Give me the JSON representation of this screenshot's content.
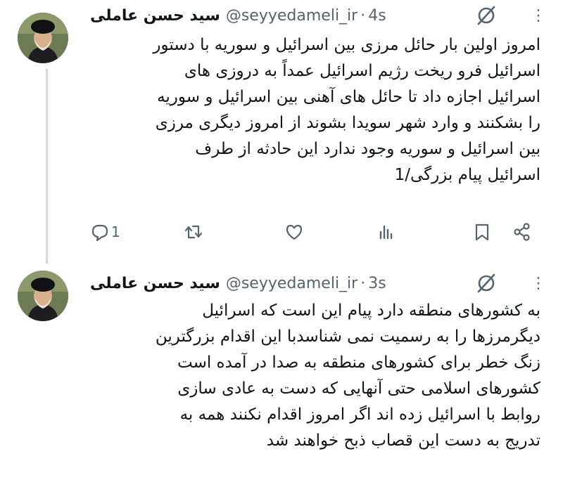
{
  "tweets": [
    {
      "author_name": "سید حسن عاملی",
      "handle": "@seyyedameli_ir",
      "separator": "·",
      "time": "4s",
      "lines": [
        "امروز اولین بار حائل مرزی بین اسرائیل و سوریه با دستور",
        "اسرائیل فرو ریخت رژیم اسرائیل عمداً به دروزی های",
        "اسرائیل اجازه داد تا حائل های آهنی بین اسرائیل و سوریه",
        "را بشکنند و وارد شهر سویدا بشوند از امروز دیگری مرزی",
        "بین اسرائیل و سوریه وجود ندارد این حادثه از طرف",
        "اسرائیل پیام بزرگی/1"
      ],
      "reply_count": "1"
    },
    {
      "author_name": "سید حسن عاملی",
      "handle": "@seyyedameli_ir",
      "separator": "·",
      "time": "3s",
      "lines": [
        "به کشورهای منطقه دارد پیام این است که اسرائیل",
        "دیگرمرزها را به رسمیت نمی شناسدبا این اقدام بزرگترین",
        "زنگ خطر برای کشورهای منطقه به صدا در آمده است",
        "کشورهای اسلامی حتی آنهایی که دست به عادی سازی",
        "روابط با اسرائیل زده اند اگر امروز اقدام نکنند همه به",
        "تدریج به دست این قصاب ذبح خواهند شد"
      ]
    }
  ],
  "icons": {
    "more": "more-icon",
    "grok": "grok-icon",
    "reply": "reply-icon",
    "retweet": "retweet-icon",
    "like": "like-icon",
    "views": "views-icon",
    "bookmark": "bookmark-icon",
    "share": "share-icon"
  },
  "colors": {
    "text": "#0f1419",
    "secondary": "#536471",
    "thread_line": "#cfd9de"
  }
}
